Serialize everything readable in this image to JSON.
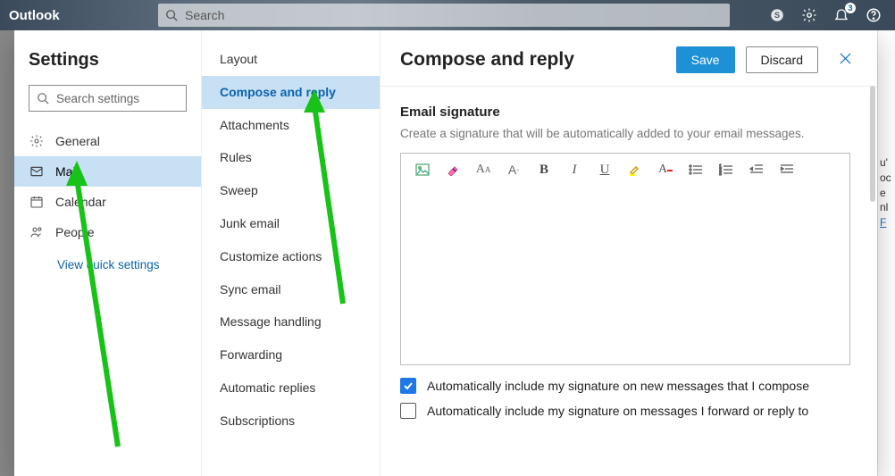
{
  "topbar": {
    "brand": "Outlook",
    "search_placeholder": "Search",
    "notification_count": "3"
  },
  "rightstrip": {
    "t1": "u'",
    "t2": "oc",
    "t3": "e",
    "t4": "nl",
    "link": "F"
  },
  "settings": {
    "title": "Settings",
    "search_placeholder": "Search settings",
    "nav": [
      {
        "icon": "gear",
        "label": "General"
      },
      {
        "icon": "mail",
        "label": "Mail"
      },
      {
        "icon": "calendar",
        "label": "Calendar"
      },
      {
        "icon": "people",
        "label": "People"
      }
    ],
    "quick_link": "View quick settings"
  },
  "submenu": {
    "items": [
      "Layout",
      "Compose and reply",
      "Attachments",
      "Rules",
      "Sweep",
      "Junk email",
      "Customize actions",
      "Sync email",
      "Message handling",
      "Forwarding",
      "Automatic replies",
      "Subscriptions"
    ],
    "selected_index": 1
  },
  "detail": {
    "title": "Compose and reply",
    "save_label": "Save",
    "discard_label": "Discard",
    "section_title": "Email signature",
    "section_sub": "Create a signature that will be automatically added to your email messages.",
    "check1": "Automatically include my signature on new messages that I compose",
    "check2": "Automatically include my signature on messages I forward or reply to",
    "check1_checked": true,
    "check2_checked": false
  }
}
